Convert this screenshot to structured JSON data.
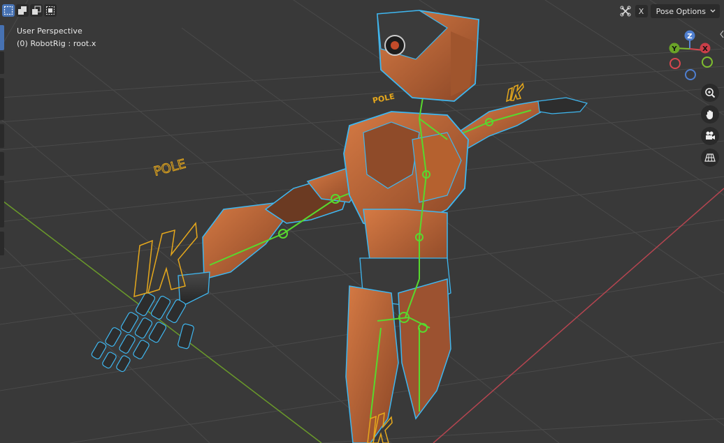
{
  "viewport": {
    "perspective_label": "User Perspective",
    "object_label": "(0) RobotRig : root.x"
  },
  "header": {
    "select_modes": [
      "select-box-new",
      "select-box-extend",
      "select-box-subtract",
      "select-box-intersect"
    ],
    "x_label": "X",
    "pose_options_label": "Pose Options"
  },
  "gizmo": {
    "z_label": "Z",
    "y_label": "Y",
    "x_label": "X"
  },
  "overlays": {
    "pole_left": "POLE",
    "pole_right": "POLE",
    "ik_left": "IK",
    "ik_right": "IK",
    "ik_bottom": "IK"
  },
  "navigation": [
    "zoom-icon",
    "hand-icon",
    "camera-icon",
    "grid-icon"
  ],
  "colors": {
    "background": "#393939",
    "grid": "#4a4a4a",
    "x_axis": "#b54550",
    "y_axis": "#6a9a2a",
    "bone_outline": "#3fb7f0",
    "bone_green": "#58d92e",
    "overlay_gold": "#e6a81c",
    "robot_orange": "#c06a3a",
    "active_blue": "#4772b3"
  }
}
